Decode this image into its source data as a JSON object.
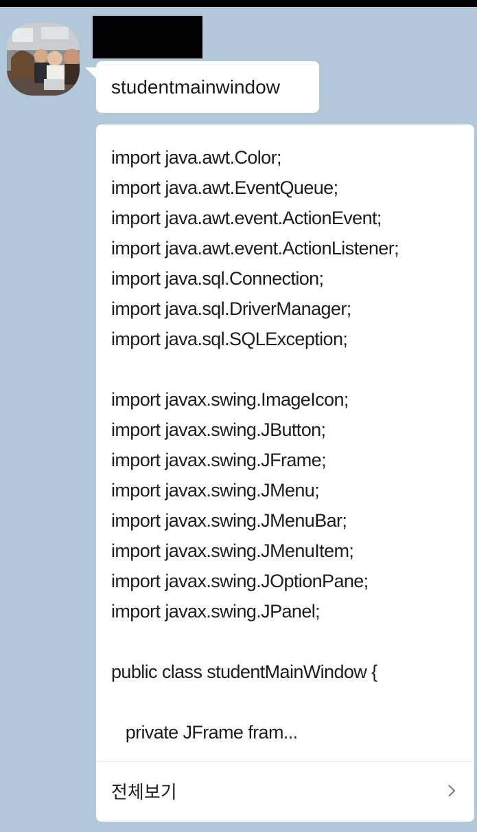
{
  "message": {
    "title": "studentmainwindow",
    "code_preview": "import java.awt.Color;\nimport java.awt.EventQueue;\nimport java.awt.event.ActionEvent;\nimport java.awt.event.ActionListener;\nimport java.sql.Connection;\nimport java.sql.DriverManager;\nimport java.sql.SQLException;\n\nimport javax.swing.ImageIcon;\nimport javax.swing.JButton;\nimport javax.swing.JFrame;\nimport javax.swing.JMenu;\nimport javax.swing.JMenuBar;\nimport javax.swing.JMenuItem;\nimport javax.swing.JOptionPane;\nimport javax.swing.JPanel;\n\npublic class studentMainWindow {\n\n   private JFrame fram...",
    "view_all_label": "전체보기",
    "view_all_icon": "chevron-right-icon"
  },
  "colors": {
    "background": "#b2c7da",
    "bubble": "#ffffff",
    "redaction": "#000000"
  }
}
